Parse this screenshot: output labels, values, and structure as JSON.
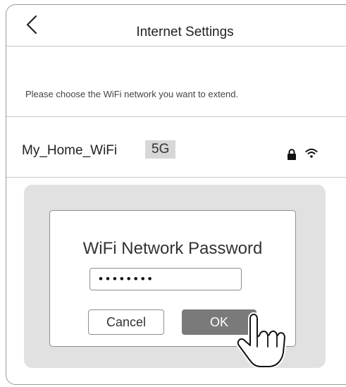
{
  "header": {
    "title": "Internet Settings",
    "back_icon": "chevron-left-icon"
  },
  "hint": "Please choose the WiFi network you want to extend.",
  "network": {
    "ssid": "My_Home_WiFi",
    "band": "5G",
    "secured": true,
    "icons": [
      "lock-icon",
      "wifi-icon"
    ]
  },
  "dialog": {
    "title": "WiFi Network Password",
    "password_value": "••••••••",
    "cancel_label": "Cancel",
    "ok_label": "OK"
  },
  "colors": {
    "overlay": "#e1e1e2",
    "ok_button": "#7a7a7a",
    "band_badge": "#d7d7d7"
  },
  "cursor_icon": "hand-pointer-icon"
}
